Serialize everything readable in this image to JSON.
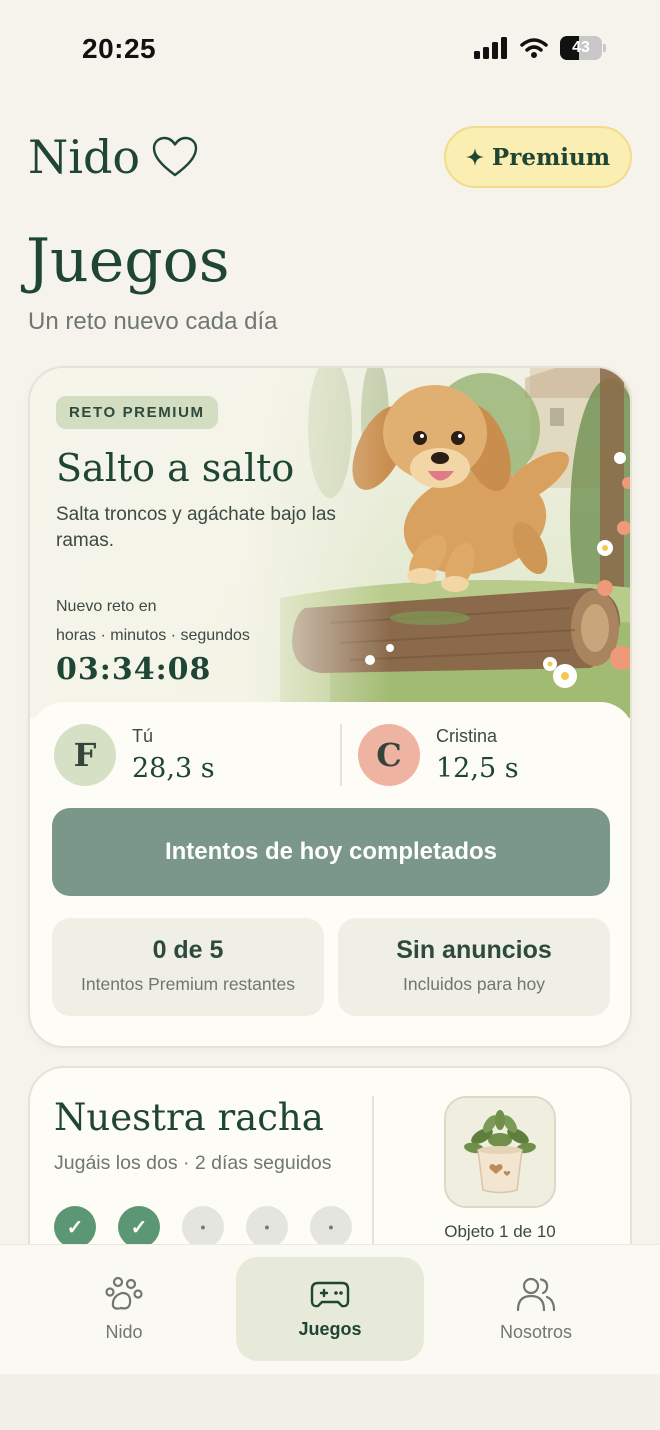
{
  "status": {
    "time": "20:25",
    "battery": "43"
  },
  "header": {
    "brand": "Nido",
    "premium_label": "Premium"
  },
  "page": {
    "title": "Juegos",
    "subtitle": "Un reto nuevo cada día"
  },
  "challenge": {
    "badge": "RETO PREMIUM",
    "title": "Salto a salto",
    "description": "Salta troncos y agáchate bajo las ramas.",
    "timer_label": "Nuevo reto en",
    "timer_units": "horas · minutos · segundos",
    "timer_value": "03:34:08"
  },
  "players": [
    {
      "initial": "F",
      "name": "Tú",
      "score": "28,3 s",
      "color": "#d5e0c4"
    },
    {
      "initial": "C",
      "name": "Cristina",
      "score": "12,5 s",
      "color": "#efb3a2"
    }
  ],
  "action": {
    "label": "Intentos de hoy completados"
  },
  "stats": [
    {
      "value": "0 de 5",
      "label": "Intentos Premium restantes"
    },
    {
      "value": "Sin anuncios",
      "label": "Incluidos para hoy"
    }
  ],
  "streak": {
    "title": "Nuestra racha",
    "subtitle": "Jugáis los dos · 2 días seguidos",
    "days": [
      "done",
      "done",
      "todo",
      "todo",
      "todo"
    ],
    "object_label": "Objeto 1 de 10"
  },
  "tabs": [
    {
      "label": "Nido",
      "icon": "paw-icon",
      "active": false
    },
    {
      "label": "Juegos",
      "icon": "gamepad-icon",
      "active": true
    },
    {
      "label": "Nosotros",
      "icon": "people-icon",
      "active": false
    }
  ],
  "colors": {
    "accent": "#1f4534",
    "button": "#7a978a",
    "streak_done": "#5b9774",
    "premium": "#fbeeb2"
  }
}
